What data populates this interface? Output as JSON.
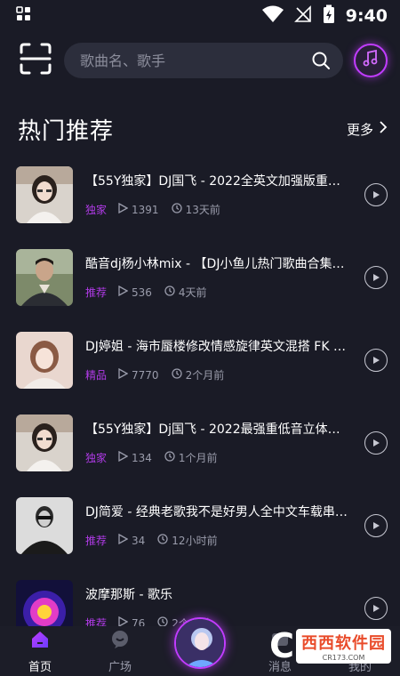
{
  "status": {
    "time": "9:40"
  },
  "search": {
    "placeholder": "歌曲名、歌手"
  },
  "section": {
    "title": "热门推荐",
    "more": "更多"
  },
  "songs": [
    {
      "title": "【55Y独家】DJ国飞 - 2022全英文加强版重低…",
      "tag": "独家",
      "plays": "1391",
      "time": "13天前"
    },
    {
      "title": "酷音dj杨小林mix - 【DJ小鱼儿热门歌曲合集…",
      "tag": "推荐",
      "plays": "536",
      "time": "4天前"
    },
    {
      "title": "DJ婷姐 - 海市蜃楼修改情感旋律英文混搭 FK H…",
      "tag": "精品",
      "plays": "7770",
      "time": "2个月前"
    },
    {
      "title": "【55Y独家】Dj国飞 - 2022最强重低音立体声…",
      "tag": "独家",
      "plays": "134",
      "time": "1个月前"
    },
    {
      "title": "DJ简爱 - 经典老歌我不是好男人全中文车载串…",
      "tag": "推荐",
      "plays": "34",
      "time": "12小时前"
    },
    {
      "title": "波摩那斯 - 歌乐",
      "tag": "推荐",
      "plays": "76",
      "time": "2个月前"
    }
  ],
  "tabs": [
    {
      "label": "首页"
    },
    {
      "label": "广场"
    },
    {
      "label": "消息"
    },
    {
      "label": "我的"
    }
  ],
  "watermark": {
    "logo": "C",
    "text": "西西软件园",
    "url": "CR173.COM"
  },
  "colors": {
    "accent": "#c13cff",
    "tag": "#b13be8",
    "background": "#1a1b26"
  }
}
